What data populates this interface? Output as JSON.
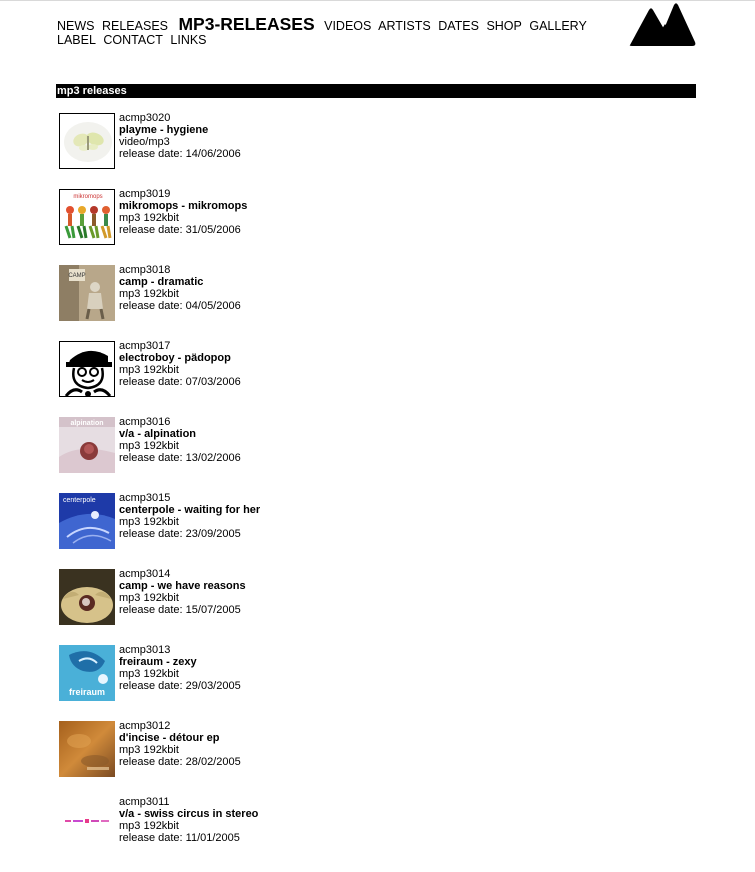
{
  "nav": {
    "items": [
      "NEWS",
      "RELEASES",
      "MP3-RELEASES",
      "VIDEOS",
      "ARTISTS",
      "DATES",
      "SHOP",
      "GALLERY",
      "LABEL",
      "CONTACT",
      "LINKS"
    ],
    "active": "MP3-RELEASES"
  },
  "logo": {
    "icon": "mountain-logo-icon"
  },
  "section": {
    "title": "mp3 releases"
  },
  "releases": [
    {
      "cat": "acmp3020",
      "title": "playme - hygiene",
      "format": "video/mp3",
      "date": "release date: 14/06/2006"
    },
    {
      "cat": "acmp3019",
      "title": "mikromops - mikromops",
      "format": "mp3 192kbit",
      "date": "release date: 31/05/2006"
    },
    {
      "cat": "acmp3018",
      "title": "camp - dramatic",
      "format": "mp3 192kbit",
      "date": "release date: 04/05/2006"
    },
    {
      "cat": "acmp3017",
      "title": "electroboy - pädopop",
      "format": "mp3 192kbit",
      "date": "release date: 07/03/2006"
    },
    {
      "cat": "acmp3016",
      "title": "v/a - alpination",
      "format": "mp3 192kbit",
      "date": "release date: 13/02/2006"
    },
    {
      "cat": "acmp3015",
      "title": "centerpole - waiting for her",
      "format": "mp3 192kbit",
      "date": "release date: 23/09/2005"
    },
    {
      "cat": "acmp3014",
      "title": "camp - we have reasons",
      "format": "mp3 192kbit",
      "date": "release date: 15/07/2005"
    },
    {
      "cat": "acmp3013",
      "title": "freiraum - zexy",
      "format": "mp3 192kbit",
      "date": "release date: 29/03/2005"
    },
    {
      "cat": "acmp3012",
      "title": "d'incise - détour ep",
      "format": "mp3 192kbit",
      "date": "release date: 28/02/2005"
    },
    {
      "cat": "acmp3011",
      "title": "v/a - swiss circus in stereo",
      "format": "mp3 192kbit",
      "date": "release date: 11/01/2005"
    }
  ],
  "covers": {
    "acmp3019": "mikromops",
    "acmp3018": "CAMP",
    "acmp3016": "alpination",
    "acmp3015": "centerpole",
    "acmp3013": "freiraum"
  }
}
